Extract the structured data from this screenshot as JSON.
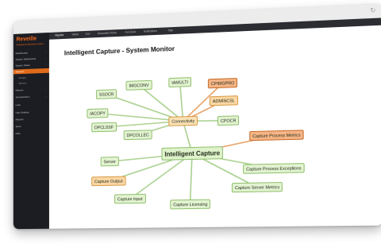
{
  "app": {
    "brand": "Reveille",
    "brand_sub": "Software for Enterprise Content"
  },
  "sidebar": {
    "items": [
      {
        "label": "Dashboards"
      },
      {
        "label": "System Dashboards"
      },
      {
        "label": "System Status"
      },
      {
        "label": "Monitors"
      },
      {
        "label": "Groups"
      },
      {
        "label": "Servers"
      },
      {
        "label": "Reports"
      },
      {
        "label": "Administration"
      },
      {
        "label": "Logs"
      },
      {
        "label": "User Settings"
      },
      {
        "label": "Reports"
      },
      {
        "label": "Send"
      },
      {
        "label": "Help"
      }
    ]
  },
  "tabs": [
    "Reports",
    "Tables",
    "Grid",
    "Associated Views",
    "Run Book",
    "Notifications",
    "Tags"
  ],
  "page": {
    "title": "Intelligent Capture - System Monitor"
  },
  "mindmap": {
    "center": "Intelligent Capture",
    "hub": "Connectivity",
    "nodes": {
      "ssocr": "SSOCR",
      "imgconv": "IMGCONV",
      "iamulti": "IAMULTI",
      "cpimgpro": "CPIMGPRO",
      "admincsl": "ADMINCSL",
      "iacopy": "IACOPY",
      "dpclssf": "DPCLSSF",
      "dpcollec": "DPCOLLEC",
      "cpocr": "CPOCR",
      "capture_process_metrics": "Capture Process Metrics",
      "server": "Server",
      "capture_process_exceptions": "Capture Process Exceptions",
      "capture_output": "Capture Output",
      "capture_server_metrics": "Capture Server Metrics",
      "capture_input": "Capture Input",
      "capture_licensing": "Capture Licensing"
    }
  },
  "colors": {
    "accent": "#e06b1b",
    "node_green": "#e3f3d2",
    "node_orange": "#fbd7a5",
    "node_deep_orange": "#f6b587",
    "link_green": "#a9d08e",
    "link_orange": "#e8a064"
  }
}
